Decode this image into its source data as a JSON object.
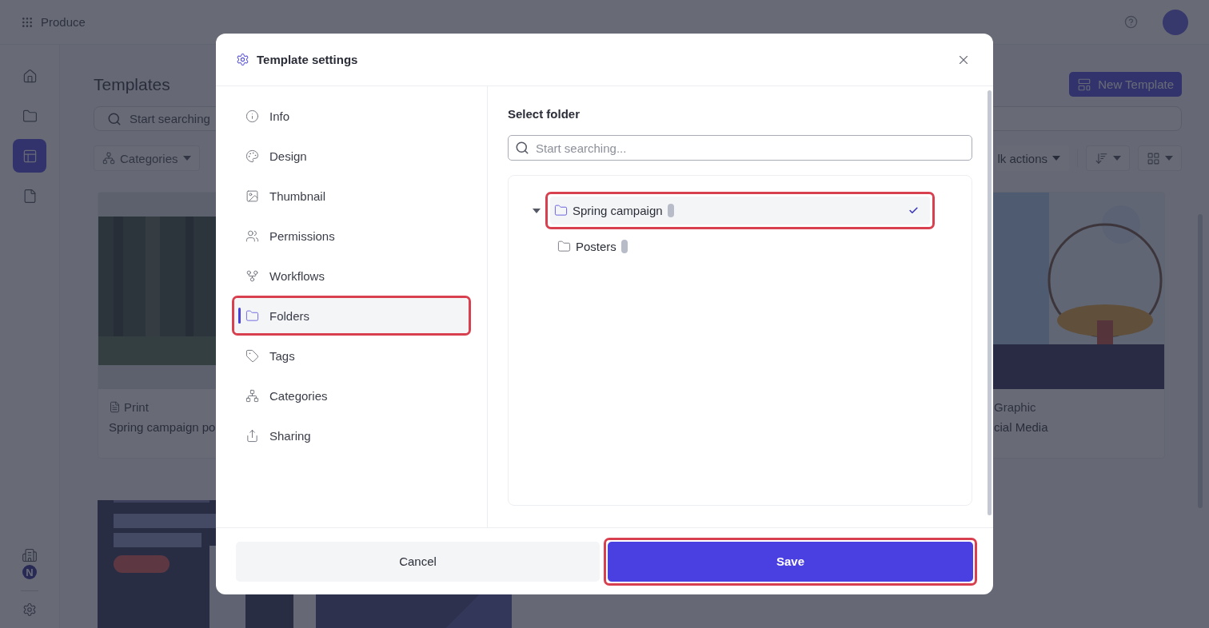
{
  "topbar": {
    "brand": "Produce"
  },
  "sidebar": {
    "items": [
      {
        "kind": "home",
        "selected": false
      },
      {
        "kind": "folder",
        "selected": false
      },
      {
        "kind": "templates",
        "selected": true
      },
      {
        "kind": "file",
        "selected": false
      }
    ],
    "badge": "N"
  },
  "page": {
    "title": "Templates",
    "new_button": "New Template",
    "search": {
      "placeholder": "Start searching"
    },
    "filters": {
      "categories": "Categories",
      "bulk_actions": "lk actions"
    },
    "cards": [
      {
        "kind": "picture",
        "category": "Print",
        "title": "Spring campaign po",
        "clipped": false
      },
      {
        "kind": "picture",
        "category": "Graphic",
        "title": "cial Media",
        "clipped": true
      }
    ]
  },
  "dialog": {
    "title": "Template settings",
    "nav": [
      {
        "label": "Info",
        "selected": false,
        "highlighted": false
      },
      {
        "label": "Design",
        "selected": false,
        "highlighted": false
      },
      {
        "label": "Thumbnail",
        "selected": false,
        "highlighted": false
      },
      {
        "label": "Permissions",
        "selected": false,
        "highlighted": false
      },
      {
        "label": "Workflows",
        "selected": false,
        "highlighted": false
      },
      {
        "label": "Folders",
        "selected": true,
        "highlighted": true
      },
      {
        "label": "Tags",
        "selected": false,
        "highlighted": false
      },
      {
        "label": "Categories",
        "selected": false,
        "highlighted": false
      },
      {
        "label": "Sharing",
        "selected": false,
        "highlighted": false
      }
    ],
    "panel": {
      "heading": "Select folder",
      "search": {
        "placeholder": "Start searching..."
      },
      "tree": [
        {
          "label": "Spring campaign",
          "expanded": true,
          "selected": true,
          "highlighted": true,
          "children": [
            {
              "label": "Posters",
              "selected": false,
              "highlighted": false
            }
          ]
        }
      ]
    },
    "buttons": [
      {
        "label": "Cancel",
        "kind": "secondary",
        "highlighted": false
      },
      {
        "label": "Save",
        "kind": "primary",
        "highlighted": true
      }
    ]
  }
}
